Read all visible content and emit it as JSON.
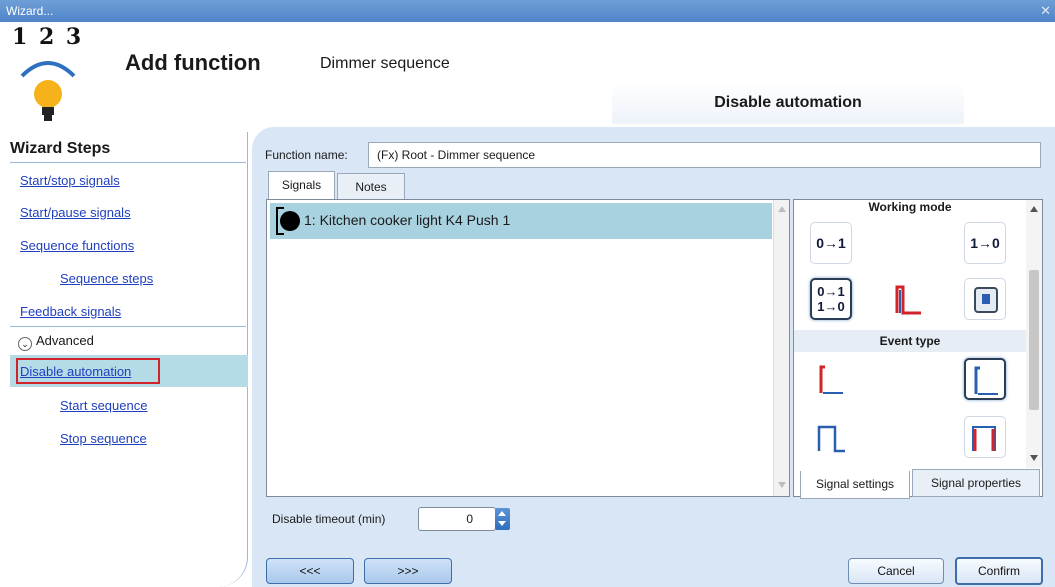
{
  "window": {
    "title": "Wizard...",
    "close_glyph": "✕"
  },
  "header": {
    "logo_digits": "1 2 3",
    "logo_icon": "lightbulb-icon",
    "title": "Add function",
    "subtitle": "Dimmer sequence",
    "step_banner": "Disable automation"
  },
  "sidebar": {
    "heading": "Wizard Steps",
    "items": [
      {
        "label": "Start/stop signals"
      },
      {
        "label": "Start/pause signals"
      },
      {
        "label": "Sequence functions"
      },
      {
        "label": "Sequence steps"
      },
      {
        "label": "Feedback signals"
      }
    ],
    "advanced_label": "Advanced",
    "advanced_items": [
      {
        "label": "Disable automation",
        "selected": true
      },
      {
        "label": "Start sequence"
      },
      {
        "label": "Stop sequence"
      }
    ]
  },
  "form": {
    "function_name_label": "Function name:",
    "function_name_value": "(Fx) Root - Dimmer sequence",
    "tabs": [
      {
        "label": "Signals",
        "active": true
      },
      {
        "label": "Notes",
        "active": false
      }
    ],
    "signals": [
      {
        "label": "1: Kitchen cooker light K4 Push 1"
      }
    ],
    "timeout_label": "Disable timeout (min)",
    "timeout_value": "0"
  },
  "right_panel": {
    "working_mode_title": "Working mode",
    "working_mode_icons": [
      {
        "name": "rising-edge-icon",
        "label": "0→1",
        "selected": false
      },
      {
        "name": "falling-edge-icon",
        "label": "1→0",
        "selected": false
      },
      {
        "name": "both-edges-icon",
        "label": "0→1\n1→0",
        "selected": true
      },
      {
        "name": "level-signal-icon",
        "label": "",
        "selected": false
      },
      {
        "name": "push-button-icon",
        "label": "",
        "selected": false
      }
    ],
    "event_type_title": "Event type",
    "event_type_icons": [
      {
        "name": "step-red-icon",
        "selected": false
      },
      {
        "name": "step-blue-icon",
        "selected": true
      },
      {
        "name": "pulse-icon",
        "selected": false
      },
      {
        "name": "pulse-red-icon",
        "selected": false
      }
    ],
    "bottom_tabs": [
      {
        "label": "Signal settings",
        "active": true
      },
      {
        "label": "Signal properties",
        "active": false
      }
    ]
  },
  "footer": {
    "back_label": "<<<",
    "next_label": ">>>",
    "cancel_label": "Cancel",
    "confirm_label": "Confirm"
  },
  "colors": {
    "accent": "#4f84c8",
    "panel_bg": "#d9e6f5",
    "selection": "#a9d2e0",
    "highlight_border": "#d2232a",
    "edge_red": "#d2232a",
    "edge_blue": "#2a5fb0"
  }
}
